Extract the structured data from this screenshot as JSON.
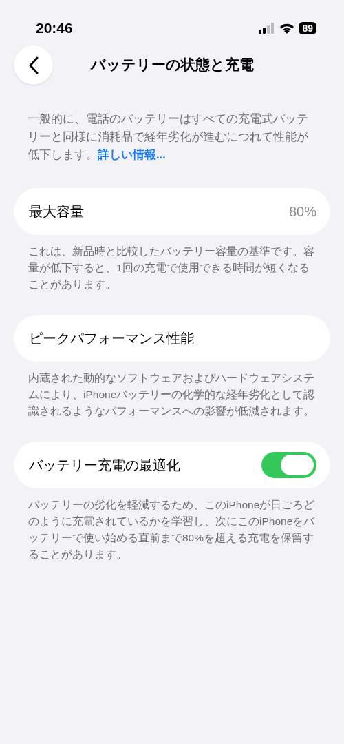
{
  "status_bar": {
    "time": "20:46",
    "battery": "89"
  },
  "nav": {
    "title": "バッテリーの状態と充電"
  },
  "intro": {
    "text": "一般的に、電話のバッテリーはすべての充電式バッテリーと同様に消耗品で経年劣化が進むにつれて性能が低下します。",
    "link": "詳しい情報..."
  },
  "sections": [
    {
      "kind": "value",
      "label": "最大容量",
      "value": "80%",
      "footer": "これは、新品時と比較したバッテリー容量の基準です。容量が低下すると、1回の充電で使用できる時間が短くなることがあります。"
    },
    {
      "kind": "plain",
      "label": "ピークパフォーマンス性能",
      "footer": "内蔵された動的なソフトウェアおよびハードウェアシステムにより、iPhoneバッテリーの化学的な経年劣化として認識されるようなパフォーマンスへの影響が低減されます。"
    },
    {
      "kind": "toggle",
      "label": "バッテリー充電の最適化",
      "on": true,
      "footer": "バッテリーの劣化を軽減するため、このiPhoneが日ごろどのように充電されているかを学習し、次にこのiPhoneをバッテリーで使い始める直前まで80%を超える充電を保留することがあります。"
    }
  ]
}
